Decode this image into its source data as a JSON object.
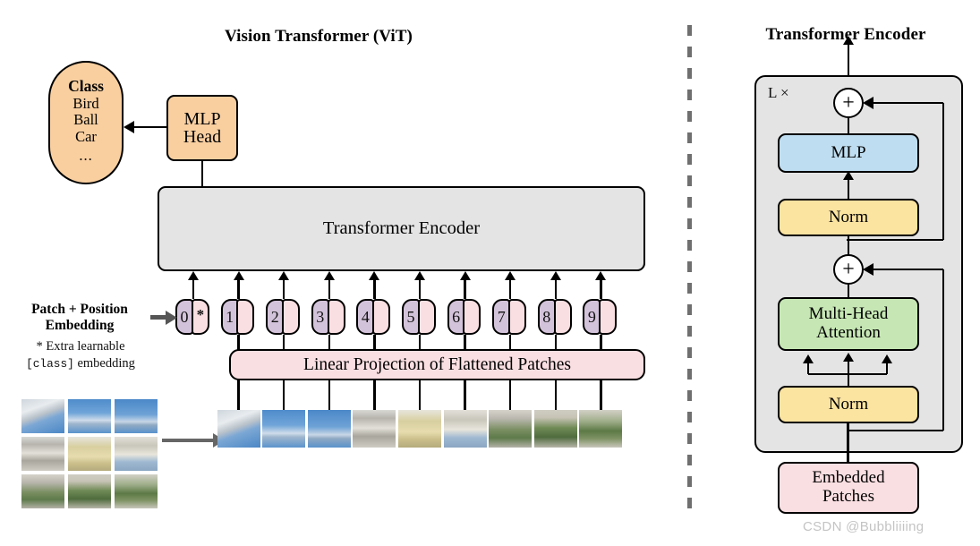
{
  "figure": {
    "left_title": "Vision Transformer (ViT)",
    "right_title": "Transformer Encoder",
    "watermark": "CSDN @Bubbliiiing"
  },
  "left_panel": {
    "class_head": {
      "heading": "Class",
      "items": [
        "Bird",
        "Ball",
        "Car"
      ],
      "ellipsis": "..."
    },
    "mlp_head": {
      "line1": "MLP",
      "line2": "Head"
    },
    "encoder_block": {
      "label": "Transformer Encoder"
    },
    "linear_projection": {
      "label": "Linear Projection of Flattened Patches"
    },
    "embedding_label": {
      "line1": "Patch + Position",
      "line2": "Embedding"
    },
    "footnote": {
      "line1": "* Extra learnable",
      "mono": "[class]",
      "line2_tail": " embedding"
    },
    "tokens": [
      {
        "index": "0",
        "mark": "*"
      },
      {
        "index": "1",
        "mark": ""
      },
      {
        "index": "2",
        "mark": ""
      },
      {
        "index": "3",
        "mark": ""
      },
      {
        "index": "4",
        "mark": ""
      },
      {
        "index": "5",
        "mark": ""
      },
      {
        "index": "6",
        "mark": ""
      },
      {
        "index": "7",
        "mark": ""
      },
      {
        "index": "8",
        "mark": ""
      },
      {
        "index": "9",
        "mark": ""
      }
    ],
    "patch_count": 9,
    "source_image_grid": {
      "rows": 3,
      "cols": 3
    }
  },
  "right_panel": {
    "repeat_label": "L ×",
    "blocks": [
      {
        "name": "residual-add-top",
        "label": "+"
      },
      {
        "name": "mlp",
        "label": "MLP"
      },
      {
        "name": "norm-top",
        "label": "Norm"
      },
      {
        "name": "residual-add-bottom",
        "label": "+"
      },
      {
        "name": "multi-head-attention",
        "line1": "Multi-Head",
        "line2": "Attention"
      },
      {
        "name": "norm-bottom",
        "label": "Norm"
      },
      {
        "name": "embedded-patches",
        "line1": "Embedded",
        "line2": "Patches"
      }
    ]
  },
  "colors": {
    "orange": "#F9CFA0",
    "pink": "#FADFE2",
    "purple": "#D3C3DA",
    "gray_panel": "#E4E4E4",
    "blue": "#BFDDF0",
    "yellow": "#FBE3A0",
    "green": "#C6E7B4",
    "stroke": "#000000",
    "divider": "#6F6F6F",
    "watermark": "#C4C4C4"
  }
}
